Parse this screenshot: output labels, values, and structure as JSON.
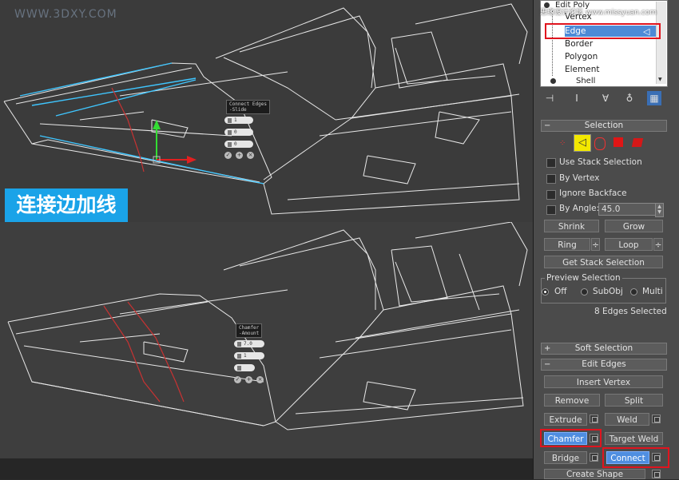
{
  "watermarks": {
    "left": "WWW.3DXY.COM",
    "right": "思缘设计论坛 www.missyuan.com"
  },
  "overlay_label": "连接边加线",
  "top_viewport": {
    "caddy_title": [
      "Connect Edges",
      "-Slide"
    ],
    "fields": [
      "1",
      "0",
      "0"
    ]
  },
  "bottom_viewport": {
    "caddy_title": [
      "Chamfer",
      "-Amount"
    ],
    "fields": [
      "7.0",
      "1",
      ""
    ]
  },
  "stack": {
    "items": [
      "Edit Poly",
      "Vertex",
      "Edge",
      "Border",
      "Polygon",
      "Element",
      "Shell"
    ],
    "selected": "Edge"
  },
  "selection": {
    "header": "Selection",
    "checkboxes": [
      "Use Stack Selection",
      "By Vertex",
      "Ignore Backface",
      "By Angle:"
    ],
    "angle_value": "45.0",
    "buttons": {
      "shrink": "Shrink",
      "grow": "Grow",
      "ring": "Ring",
      "loop": "Loop",
      "get_stack": "Get Stack Selection"
    },
    "preview": {
      "title": "Preview Selection",
      "off": "Off",
      "subobj": "SubObj",
      "multi": "Multi"
    },
    "status": "8 Edges Selected"
  },
  "soft_selection": {
    "header": "Soft Selection"
  },
  "edit_edges": {
    "header": "Edit Edges",
    "insert_vertex": "Insert Vertex",
    "remove": "Remove",
    "split": "Split",
    "extrude": "Extrude",
    "weld": "Weld",
    "chamfer": "Chamfer",
    "target_weld": "Target Weld",
    "bridge": "Bridge",
    "connect": "Connect",
    "create_shape": "Create Shape"
  },
  "colors": {
    "selected_edge": "#3fc6ff",
    "highlight": "#4f8ee0",
    "callout": "#e0141e",
    "label_bg": "#1aa3e8"
  }
}
